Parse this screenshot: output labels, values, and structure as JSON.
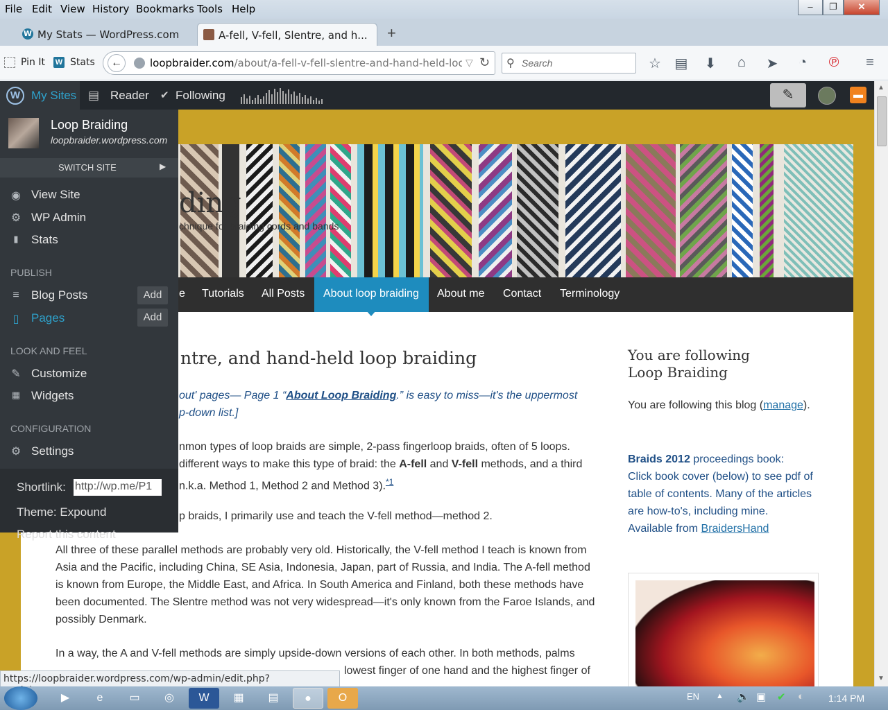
{
  "menubar": {
    "items": [
      "File",
      "Edit",
      "View",
      "History",
      "Bookmarks",
      "Tools",
      "Help"
    ]
  },
  "window_controls": {
    "minimize": "–",
    "restore": "❐",
    "close": "✕"
  },
  "tabs": [
    {
      "title": "My Stats — WordPress.com",
      "close": "×"
    },
    {
      "title": "A-fell, V-fell, Slentre, and h...",
      "close": "×"
    }
  ],
  "new_tab": "+",
  "bookmarks": {
    "pinit": "Pin It",
    "stats": "Stats"
  },
  "url": {
    "domain": "loopbraider.com",
    "path": "/about/a-fell-v-fell-slentre-and-hand-held-loop-br"
  },
  "search": {
    "placeholder": "Search"
  },
  "wpbar": {
    "my_sites": "My Sites",
    "reader": "Reader",
    "following": "Following"
  },
  "flyout": {
    "site_title": "Loop Braiding",
    "site_url": "loopbraider.wordpress.com",
    "switch_site": "SWITCH SITE",
    "view_site": "View Site",
    "wp_admin": "WP Admin",
    "stats": "Stats",
    "publish": "PUBLISH",
    "blog_posts": "Blog Posts",
    "pages": "Pages",
    "add": "Add",
    "look_and_feel": "LOOK AND FEEL",
    "customize": "Customize",
    "widgets": "Widgets",
    "configuration": "CONFIGURATION",
    "settings": "Settings",
    "shortlink_label": "Shortlink:",
    "shortlink_value": "http://wp.me/P1",
    "theme": "Theme: Expound",
    "report": "Report this content"
  },
  "site": {
    "title_fragment": "ding",
    "tagline_fragment": "chnique for braiding cords and bands",
    "menu": [
      "e",
      "Tutorials",
      "All Posts",
      "About loop braiding",
      "About me",
      "Contact",
      "Terminology"
    ],
    "post_title": "ntre, and hand-held loop braiding",
    "intro_1a": "out' pages— Page 1 “",
    "intro_link": "About Loop Braiding",
    "intro_1b": ".” is easy to miss—it's the uppermost",
    "intro_2": "p-down list.]",
    "p1_l1": "nmon types of loop braids are simple, 2-pass fingerloop braids, often of 5 loops.",
    "p1_l2a": "different ways to make this type of braid: the ",
    "p1_afell": "A-fell",
    "p1_and": " and ",
    "p1_vfell": "V-fell",
    "p1_l2b": " methods, and a third",
    "p1_l3": "n.k.a. Method 1, Method 2 and Method 3).",
    "p1_fn": "*1",
    "p2": "p braids, I primarily use and teach the V-fell method—method 2.",
    "p3": [
      "All three of these parallel methods are probably very old. Historically, the V-fell method I teach is known from",
      "Asia and the Pacific, including China, SE Asia, Indonesia, Japan, part of Russia, and India. The A-fell method",
      "is known from Europe, the Middle East, and Africa. In South America and Finland, both these methods have",
      "been documented.  The Slentre method was not very widespread—it's only known from the Faroe Islands, and",
      "possibly Denmark."
    ],
    "p4_l1": "In a way, the A and V-fell methods are simply upside-down versions of each other. In both methods, palms",
    "p4_l2": "lowest finger of one hand and the highest finger of",
    "sidebar": {
      "heading": "You are following Loop Braiding",
      "following_a": "You are following this blog (",
      "manage": "manage",
      "following_b": ").",
      "book_bold": "Braids 2012",
      "book_rest": " proceedings book:",
      "book_l2": "Click book cover (below) to see pdf of",
      "book_l3": "table of contents. Many of the articles",
      "book_l4": "are how-to's, including mine.",
      "available": "Available from ",
      "braidershand": "BraidersHand"
    }
  },
  "status_url": "https://loopbraider.wordpress.com/wp-admin/edit.php?post_type=page",
  "taskbar": {
    "lang": "EN",
    "time": "1:14 PM"
  },
  "colors": {
    "wp_blue": "#1e8cbe",
    "page_bg": "#c9a227",
    "admin_bar": "#23282d",
    "flyout": "#32373c"
  }
}
